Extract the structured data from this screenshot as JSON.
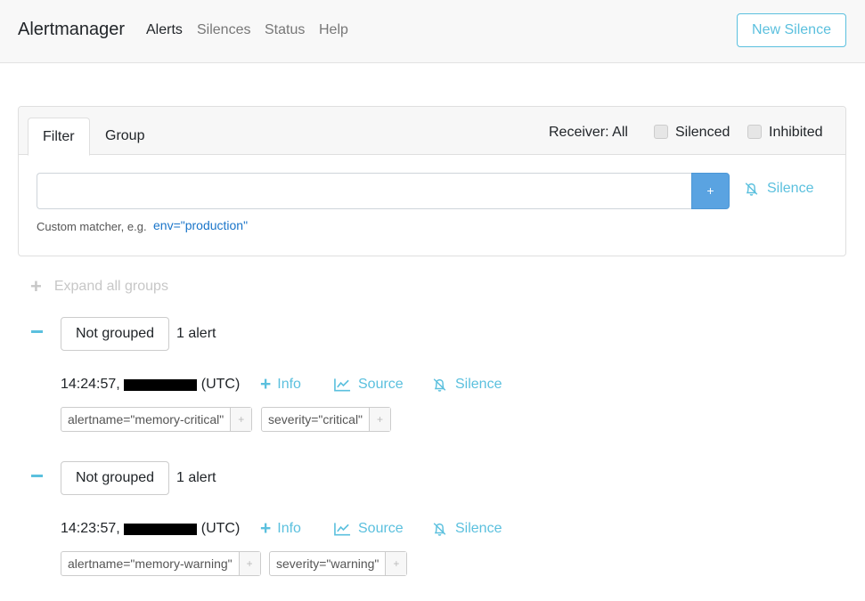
{
  "nav": {
    "brand": "Alertmanager",
    "links": [
      "Alerts",
      "Silences",
      "Status",
      "Help"
    ],
    "new_silence": "New Silence"
  },
  "filter": {
    "tabs": [
      "Filter",
      "Group"
    ],
    "receiver": "Receiver: All",
    "silenced": "Silenced",
    "inhibited": "Inhibited",
    "input_value": "",
    "add_button": "+",
    "silence_link": "Silence",
    "hint": "Custom matcher, e.g.",
    "hint_example": "env=\"production\""
  },
  "expand_all": "Expand all groups",
  "groups": [
    {
      "button": "Not grouped",
      "count": "1 alert",
      "time": "14:24:57,",
      "tz": "(UTC)",
      "actions": [
        "Info",
        "Source",
        "Silence"
      ],
      "labels": [
        "alertname=\"memory-critical\"",
        "severity=\"critical\""
      ]
    },
    {
      "button": "Not grouped",
      "count": "1 alert",
      "time": "14:23:57,",
      "tz": "(UTC)",
      "actions": [
        "Info",
        "Source",
        "Silence"
      ],
      "labels": [
        "alertname=\"memory-warning\"",
        "severity=\"warning\""
      ]
    }
  ],
  "icons": {
    "silence": "bell-slash-icon",
    "source": "chart-line-icon",
    "info": "plus-icon",
    "collapse": "minus-icon",
    "expand": "plus-icon"
  },
  "colors": {
    "accent": "#5bc0de",
    "primary_button": "#5aa3e1",
    "link": "#1a75c9"
  }
}
